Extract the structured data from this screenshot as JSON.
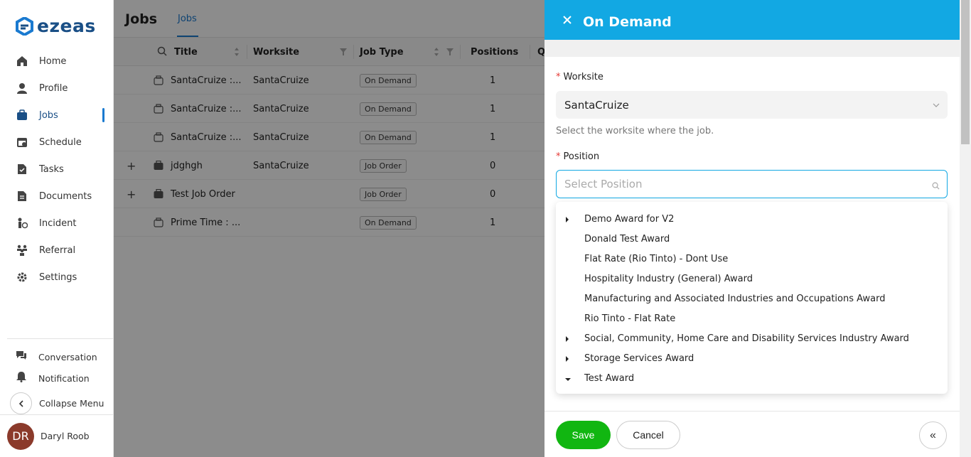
{
  "app": {
    "logo_text": "ezeas"
  },
  "sidebar": {
    "items": [
      {
        "label": "Home",
        "icon": "home-icon"
      },
      {
        "label": "Profile",
        "icon": "user-icon"
      },
      {
        "label": "Jobs",
        "icon": "briefcase-icon",
        "active": true
      },
      {
        "label": "Schedule",
        "icon": "calendar-icon"
      },
      {
        "label": "Tasks",
        "icon": "clipboard-icon"
      },
      {
        "label": "Documents",
        "icon": "document-icon"
      },
      {
        "label": "Incident",
        "icon": "incident-icon"
      },
      {
        "label": "Referral",
        "icon": "referral-icon"
      },
      {
        "label": "Settings",
        "icon": "gear-icon"
      }
    ],
    "bottom": [
      {
        "label": "Conversation",
        "icon": "chat-icon"
      },
      {
        "label": "Notification",
        "icon": "bell-icon"
      }
    ],
    "collapse_label": "Collapse Menu",
    "user": {
      "initials": "DR",
      "name": "Daryl Roob"
    }
  },
  "main": {
    "title": "Jobs",
    "tab": "Jobs",
    "columns": {
      "title": "Title",
      "worksite": "Worksite",
      "job_type": "Job Type",
      "positions": "Positions",
      "next": "Q"
    },
    "rows": [
      {
        "expand": "",
        "title": "SantaCruize :...",
        "worksite": "SantaCruize",
        "job_type": "On Demand",
        "positions": "1",
        "next": ""
      },
      {
        "expand": "",
        "title": "SantaCruize :...",
        "worksite": "SantaCruize",
        "job_type": "On Demand",
        "positions": "1",
        "next": ""
      },
      {
        "expand": "",
        "title": "SantaCruize :...",
        "worksite": "SantaCruize",
        "job_type": "On Demand",
        "positions": "1",
        "next": ""
      },
      {
        "expand": "+",
        "title": "jdghgh",
        "worksite": "SantaCruize",
        "job_type": "Job Order",
        "positions": "0",
        "next": ""
      },
      {
        "expand": "+",
        "title": "Test Job Order",
        "worksite": "",
        "job_type": "Job Order",
        "positions": "0",
        "next": ""
      },
      {
        "expand": "",
        "title": "Prime Time : ...",
        "worksite": "",
        "job_type": "On Demand",
        "positions": "1",
        "next": ""
      }
    ]
  },
  "drawer": {
    "title": "On Demand",
    "worksite": {
      "label": "Worksite",
      "required_mark": "*",
      "value": "SantaCruize",
      "hint": "Select the worksite where the job."
    },
    "position": {
      "label": "Position",
      "required_mark": "*",
      "placeholder": "Select Position"
    },
    "options": [
      {
        "label": "Demo Award for V2",
        "caret": "right"
      },
      {
        "label": "Donald Test Award",
        "caret": "none"
      },
      {
        "label": "Flat Rate (Rio Tinto) - Dont Use",
        "caret": "none"
      },
      {
        "label": "Hospitality Industry (General) Award",
        "caret": "none"
      },
      {
        "label": "Manufacturing and Associated Industries and Occupations Award",
        "caret": "none"
      },
      {
        "label": "Rio Tinto - Flat Rate",
        "caret": "none"
      },
      {
        "label": "Social, Community, Home Care and Disability Services Industry Award",
        "caret": "right"
      },
      {
        "label": "Storage Services Award",
        "caret": "right"
      },
      {
        "label": "Test Award",
        "caret": "down"
      }
    ],
    "save_label": "Save",
    "cancel_label": "Cancel",
    "collapse_label": "«"
  },
  "colors": {
    "accent": "#12a8e3",
    "brand": "#1a4f86",
    "save": "#11b611",
    "required": "#e53935"
  }
}
